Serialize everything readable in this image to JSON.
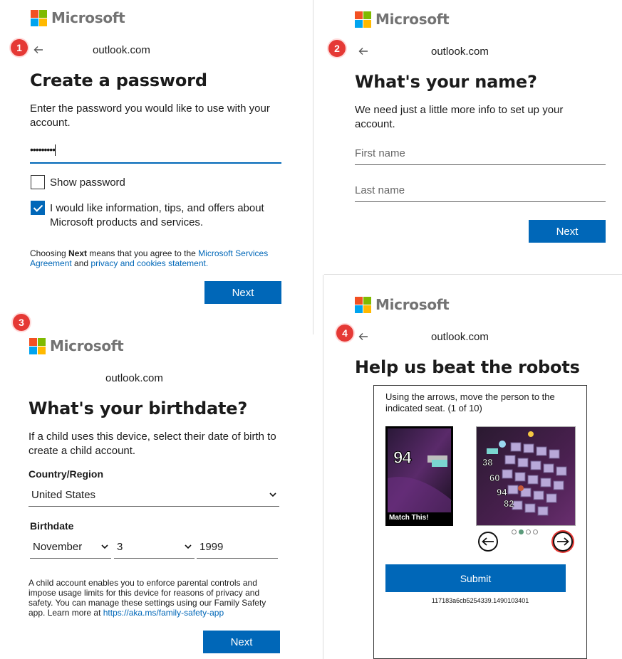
{
  "brand": {
    "name": "Microsoft",
    "colors": {
      "red": "#f25022",
      "green": "#7fba00",
      "blue": "#00a4ef",
      "yellow": "#ffb900",
      "accent": "#0067b8"
    }
  },
  "panel1": {
    "step": "1",
    "email": "outlook.com",
    "title": "Create a password",
    "description": "Enter the password you would like to use with your account.",
    "password_value": "•••••••••",
    "show_password_label": "Show password",
    "show_password_checked": false,
    "info_opt_in_label": "I would like information, tips, and offers about Microsoft products and services.",
    "info_opt_in_checked": true,
    "legal_prefix": "Choosing ",
    "legal_bold": "Next",
    "legal_mid": " means that you agree to the ",
    "legal_link1": "Microsoft Services Agreement",
    "legal_and": " and ",
    "legal_link2": "privacy and cookies statement.",
    "next_label": "Next"
  },
  "panel2": {
    "step": "2",
    "email": "outlook.com",
    "title": "What's your name?",
    "description": "We need just a little more info to set up your account.",
    "first_name_placeholder": "First name",
    "last_name_placeholder": "Last name",
    "next_label": "Next"
  },
  "panel3": {
    "step": "3",
    "email": "outlook.com",
    "title": "What's your birthdate?",
    "description": "If a child uses this device, select their date of birth to create a child account.",
    "country_label": "Country/Region",
    "country_value": "United States",
    "birthdate_label": "Birthdate",
    "month_value": "November",
    "day_value": "3",
    "year_value": "1999",
    "child_info": "A child account enables you to enforce parental controls and impose usage limits for this device for reasons of privacy and safety. You can manage these settings using our Family Safety app. Learn more at ",
    "child_link": "https://aka.ms/family-safety-app",
    "next_label": "Next"
  },
  "panel4": {
    "step": "4",
    "email": "outlook.com",
    "title": "Help us beat the robots",
    "instruction": "Using the arrows, move the person to the indicated seat. (1 of 10)",
    "target_number": "94",
    "match_label": "Match This!",
    "seat_numbers": [
      "38",
      "60",
      "94",
      "82"
    ],
    "submit_label": "Submit",
    "captcha_id": "117183a6cb5254339.1490103401",
    "carousel_index": 2,
    "carousel_count": 4
  }
}
